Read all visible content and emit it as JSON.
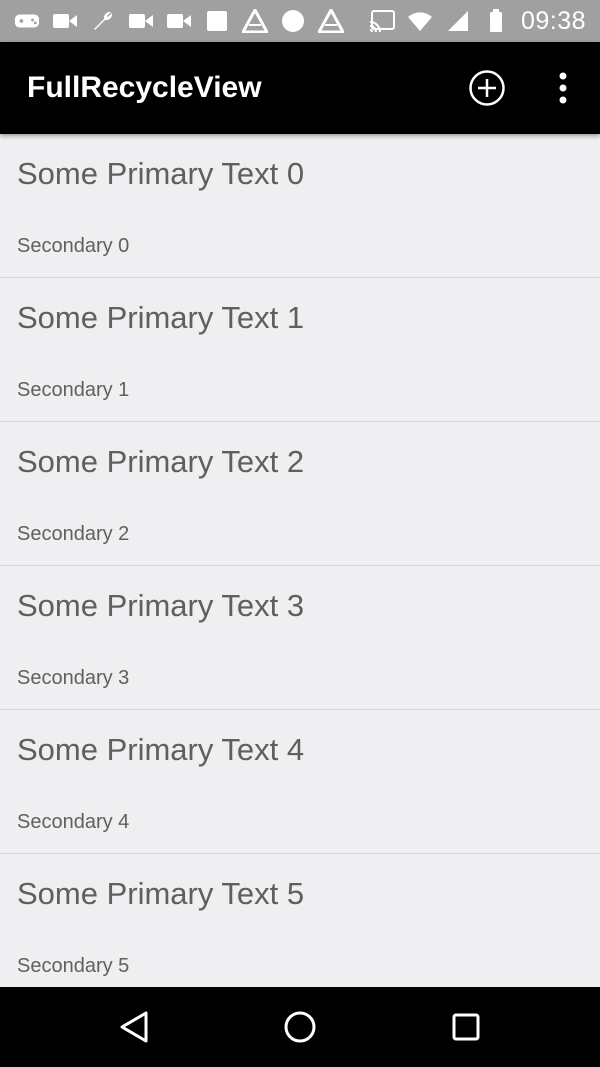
{
  "status_bar": {
    "time": "09:38",
    "icons_left": [
      "gamepad-icon",
      "videocam-icon",
      "wrench-icon",
      "videocam-icon",
      "videocam-icon",
      "square-icon",
      "triangle-logo-icon",
      "circle-icon",
      "triangle-logo-icon"
    ],
    "icons_right": [
      "cast-icon",
      "wifi-icon",
      "signal-icon",
      "battery-icon"
    ]
  },
  "toolbar": {
    "title": "FullRecycleView",
    "add_icon": "add-circle-icon",
    "more_icon": "more-vert-icon"
  },
  "list": {
    "items": [
      {
        "primary": "Some Primary Text 0",
        "secondary": "Secondary 0"
      },
      {
        "primary": "Some Primary Text 1",
        "secondary": "Secondary 1"
      },
      {
        "primary": "Some Primary Text 2",
        "secondary": "Secondary 2"
      },
      {
        "primary": "Some Primary Text 3",
        "secondary": "Secondary 3"
      },
      {
        "primary": "Some Primary Text 4",
        "secondary": "Secondary 4"
      },
      {
        "primary": "Some Primary Text 5",
        "secondary": "Secondary 5"
      }
    ]
  },
  "nav_bar": {
    "back_icon": "back-triangle-icon",
    "home_icon": "home-circle-icon",
    "recents_icon": "recents-square-icon"
  },
  "colors": {
    "status_bar": "#a0a0a0",
    "toolbar": "#000000",
    "background": "#efeef0",
    "primary_text": "#5f5f5f",
    "divider": "#d6d6d8"
  }
}
